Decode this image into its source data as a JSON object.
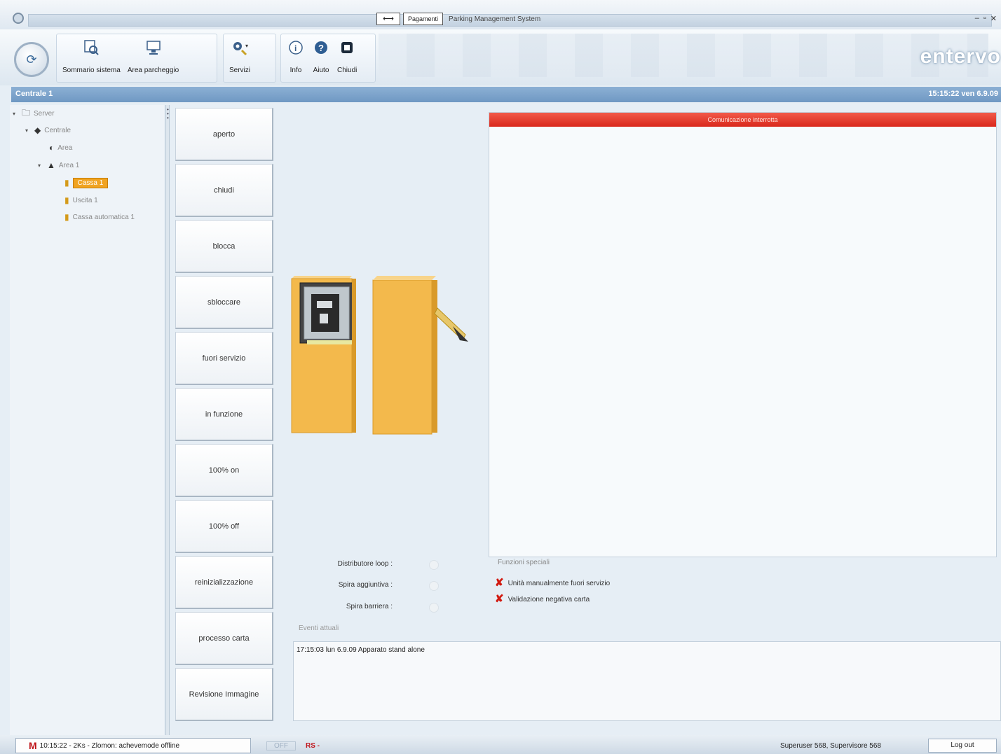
{
  "titlebar": {
    "nav_arrows": "⟷",
    "tab_label": "Pagamenti",
    "window_title": "Parking Management System"
  },
  "ribbon": {
    "orb_icon": "app-orb-icon",
    "buttons": [
      {
        "label": "Sommario sistema",
        "icon": "system-overview-icon"
      },
      {
        "label": "Area parcheggio",
        "icon": "parking-area-icon"
      },
      {
        "label": "Servizi",
        "icon": "services-icon"
      },
      {
        "label": "Info",
        "icon": "info-icon"
      },
      {
        "label": "Aiuto",
        "icon": "help-icon"
      },
      {
        "label": "Chiudi",
        "icon": "close-icon"
      }
    ],
    "brand": "entervo"
  },
  "status_bar": {
    "left_text": "Centrale 1",
    "right_text": "15:15:22 ven 6.9.09"
  },
  "tree": {
    "nodes": [
      {
        "label": "Server",
        "level": 0
      },
      {
        "label": "Centrale",
        "level": 1
      },
      {
        "label": "Area",
        "level": 2
      },
      {
        "label": "Area 1",
        "level": 2
      },
      {
        "label": "Cassa 1",
        "level": 3,
        "selected": true
      },
      {
        "label": "Uscita 1",
        "level": 3
      },
      {
        "label": "Cassa automatica 1",
        "level": 3
      }
    ]
  },
  "commands": [
    "aperto",
    "chiudi",
    "blocca",
    "sbloccare",
    "fuori servizio",
    "in funzione",
    "100% on",
    "100% off",
    "reinizializzazione",
    "processo carta",
    "Revisione Immagine"
  ],
  "alarm_panel": {
    "title": "Comunicazione interrotta"
  },
  "status": {
    "labels": [
      "Distributore loop :",
      "Spira aggiuntiva :",
      "Spira barriera :"
    ]
  },
  "functions": {
    "title": "Funzioni speciali",
    "items": [
      "Unità manualmente fuori servizio",
      "Validazione negativa carta"
    ]
  },
  "events": {
    "title": "Eventi attuali",
    "entries": [
      "17:15:03 lun 6.9.09   Apparato stand alone"
    ]
  },
  "taskbar": {
    "app_entry": "10:15:22 - 2Ks - Zlomon: achevemode offline",
    "mid_a": "OFF",
    "mid_b": "RS -",
    "user_info": "Superuser 568, Supervisore 568",
    "logout": "Log out"
  },
  "colors": {
    "alarm_red": "#e03a2c",
    "selection_orange": "#f0a322",
    "status_bar_blue": "#7aa2cc",
    "device_yellow": "#f3b94c"
  }
}
